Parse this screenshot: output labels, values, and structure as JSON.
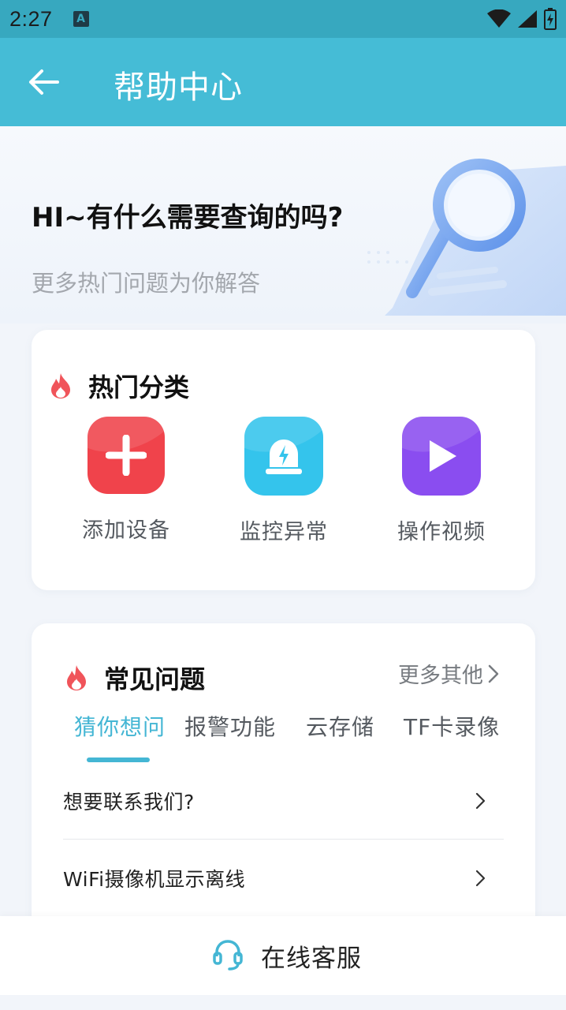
{
  "status_bar": {
    "time": "2:27",
    "notification_badge": "A"
  },
  "app_bar": {
    "title": "帮助中心",
    "back_icon": "arrow-left-icon"
  },
  "hero": {
    "heading": "HI~有什么需要查询的吗?",
    "subheading": "更多热门问题为你解答"
  },
  "hot_categories": {
    "title": "热门分类",
    "items": [
      {
        "label": "添加设备",
        "icon": "plus-icon",
        "color": "#f0434b"
      },
      {
        "label": "监控异常",
        "icon": "alarm-light-icon",
        "color": "#34c4ec"
      },
      {
        "label": "操作视频",
        "icon": "play-icon",
        "color": "#8a4df0"
      }
    ]
  },
  "faq": {
    "title": "常见问题",
    "more_label": "更多其他",
    "tabs": [
      "猜你想问",
      "报警功能",
      "云存储",
      "TF卡录像"
    ],
    "active_tab": 0,
    "questions": [
      "想要联系我们?",
      "WiFi摄像机显示离线"
    ]
  },
  "bottom_bar": {
    "label": "在线客服",
    "icon": "headset-icon"
  },
  "colors": {
    "accent": "#44b6d4",
    "appbar": "#45bcd6",
    "statusbar": "#37a8bf"
  }
}
